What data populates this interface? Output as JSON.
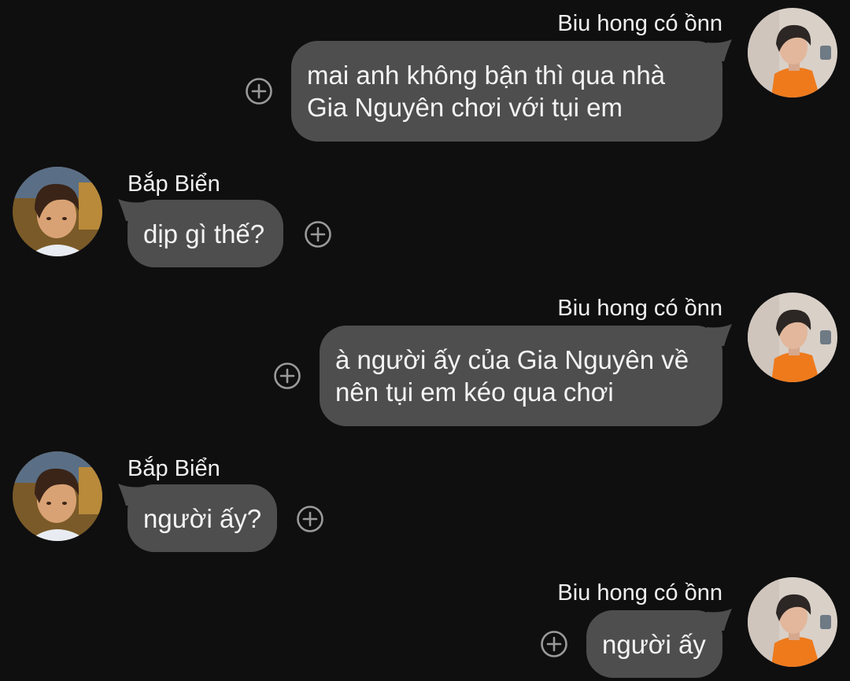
{
  "messages": [
    {
      "sender": "Biu hong có ồnn",
      "lines": [
        "mai anh không bận thì qua nhà",
        "Gia Nguyên chơi với tụi em"
      ]
    },
    {
      "sender": "Bắp Biển",
      "lines": [
        "dịp gì thế?"
      ]
    },
    {
      "sender": "Biu hong có ồnn",
      "lines": [
        "à người ấy của Gia Nguyên về",
        "nên tụi em kéo qua chơi"
      ]
    },
    {
      "sender": "Bắp Biển",
      "lines": [
        "người ấy?"
      ]
    },
    {
      "sender": "Biu hong có ồnn",
      "lines": [
        "người ấy"
      ]
    }
  ],
  "colors": {
    "background": "#0f0f10",
    "bubble": "#4e4e4e",
    "text": "#f4f4f4",
    "react_icon": "#9a9a9a"
  },
  "icons": {
    "react": "add-reaction-icon",
    "avatar_self": "user-avatar-orange-shirt",
    "avatar_other": "user-avatar-boy"
  }
}
